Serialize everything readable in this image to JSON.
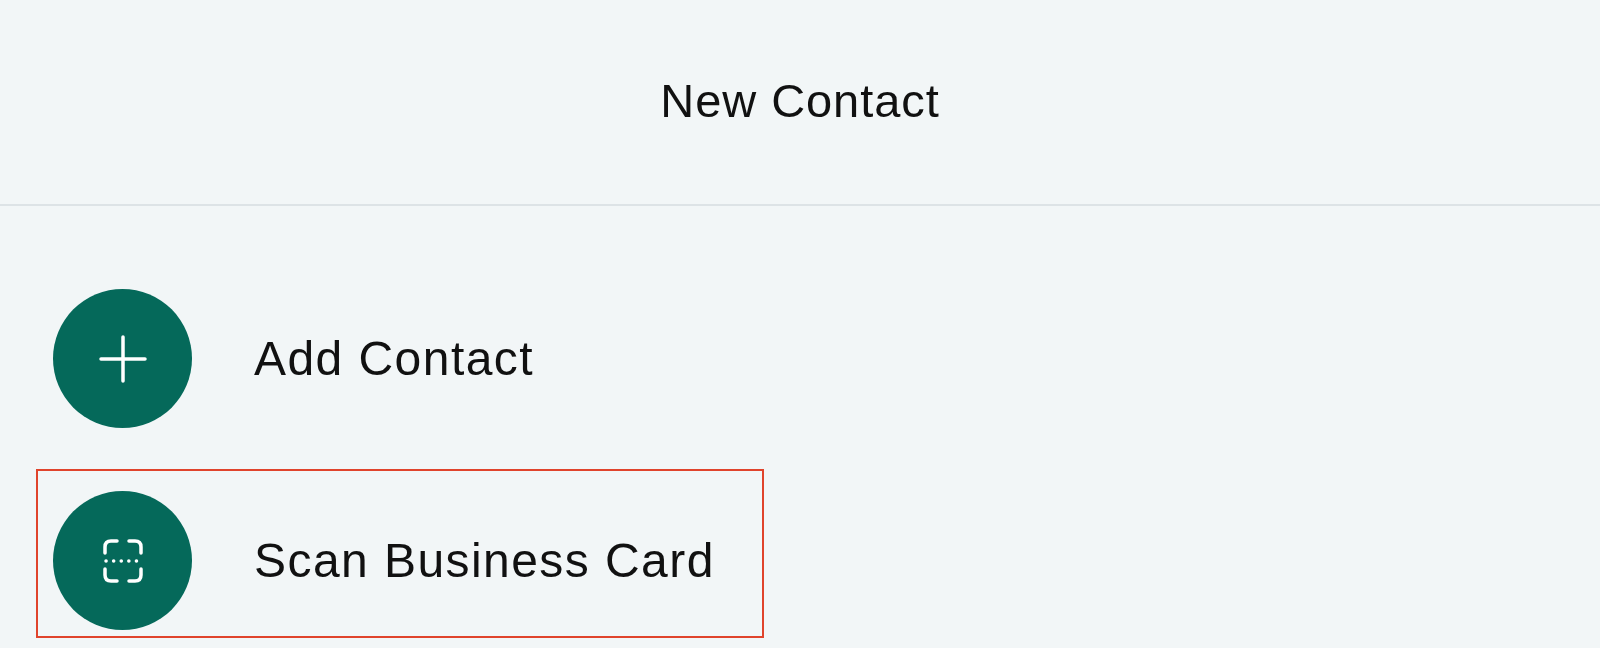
{
  "header": {
    "title": "New Contact"
  },
  "actions": [
    {
      "kind": "add",
      "label": "Add Contact",
      "highlighted": false
    },
    {
      "kind": "scan",
      "label": "Scan Business Card",
      "highlighted": true
    }
  ]
}
